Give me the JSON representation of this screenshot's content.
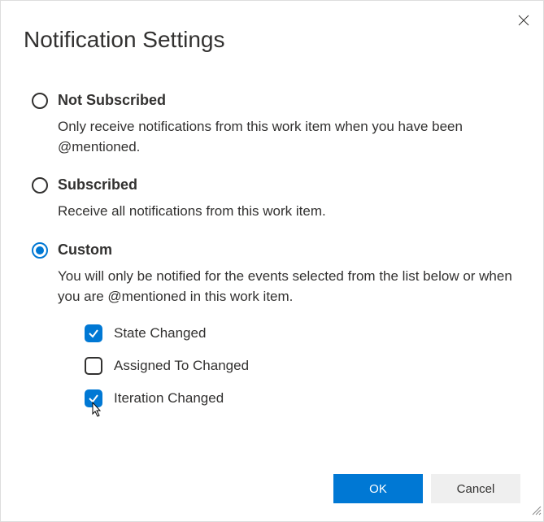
{
  "title": "Notification Settings",
  "options": {
    "not_subscribed": {
      "label": "Not Subscribed",
      "desc": "Only receive notifications from this work item when you have been @mentioned."
    },
    "subscribed": {
      "label": "Subscribed",
      "desc": "Receive all notifications from this work item."
    },
    "custom": {
      "label": "Custom",
      "desc": "You will only be notified for the events selected from the list below or when you are @mentioned in this work item."
    }
  },
  "checkboxes": {
    "state_changed": "State Changed",
    "assigned_to_changed": "Assigned To Changed",
    "iteration_changed": "Iteration Changed"
  },
  "buttons": {
    "ok": "OK",
    "cancel": "Cancel"
  }
}
